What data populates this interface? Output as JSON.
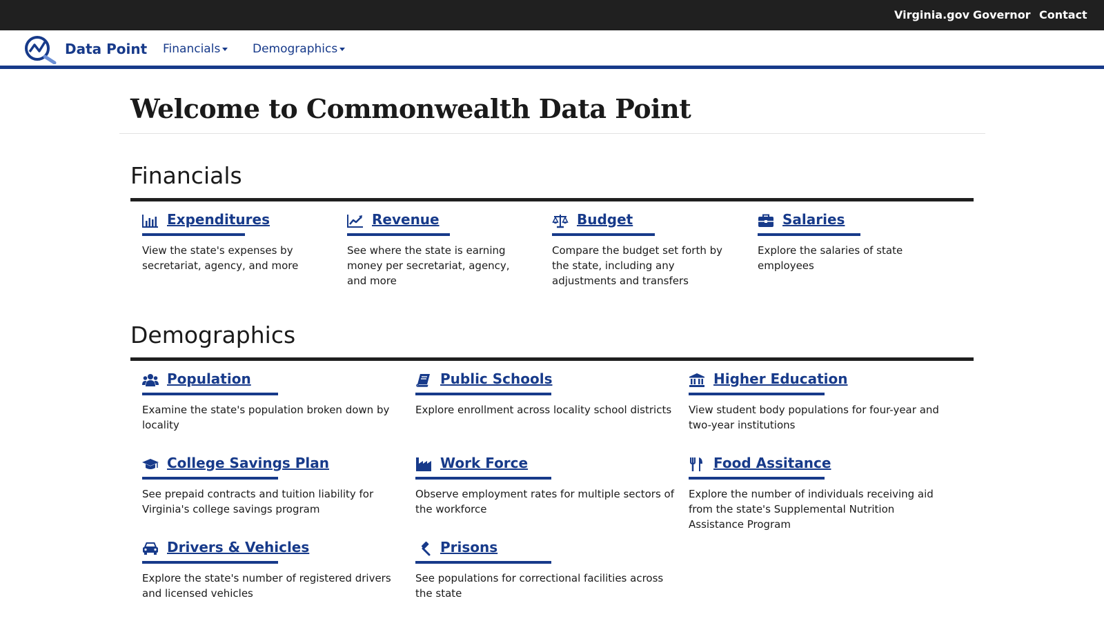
{
  "topbar": {
    "links": [
      "Virginia.gov",
      "Governor",
      "Contact"
    ]
  },
  "navbar": {
    "brand": "Data Point",
    "menus": [
      "Financials",
      "Demographics"
    ]
  },
  "page": {
    "title": "Welcome to Commonwealth Data Point"
  },
  "financials": {
    "heading": "Financials",
    "cards": [
      {
        "title": "Expenditures",
        "icon": "bar-chart-icon",
        "description": "View the state's expenses by secretariat, agency, and more"
      },
      {
        "title": "Revenue",
        "icon": "line-chart-icon",
        "description": "See where the state is earning money per secretariat, agency, and more"
      },
      {
        "title": "Budget",
        "icon": "balance-scale-icon",
        "description": "Compare the budget set forth by the state, including any adjustments and transfers"
      },
      {
        "title": "Salaries",
        "icon": "briefcase-icon",
        "description": "Explore the salaries of state employees"
      }
    ]
  },
  "demographics": {
    "heading": "Demographics",
    "cards": [
      {
        "title": "Population",
        "icon": "users-icon",
        "description": "Examine the state's population broken down by locality"
      },
      {
        "title": "Public Schools",
        "icon": "book-icon",
        "description": "Explore enrollment across locality school districts"
      },
      {
        "title": "Higher Education",
        "icon": "university-icon",
        "description": "View student body populations for four-year and two-year institutions"
      },
      {
        "title": "College Savings Plan",
        "icon": "graduation-cap-icon",
        "description": "See prepaid contracts and tuition liability for Virginia's college savings program"
      },
      {
        "title": "Work Force",
        "icon": "industry-icon",
        "description": "Observe employment rates for multiple sectors of the workforce"
      },
      {
        "title": "Food Assitance",
        "icon": "utensils-icon",
        "description": "Explore the number of individuals receiving aid from the state's Supplemental Nutrition Assistance Program"
      },
      {
        "title": "Drivers & Vehicles",
        "icon": "car-icon",
        "description": "Explore the state's number of registered drivers and licensed vehicles"
      },
      {
        "title": "Prisons",
        "icon": "gavel-icon",
        "description": "See populations for correctional facilities across the state"
      }
    ]
  },
  "colors": {
    "brand_blue": "#173a8a",
    "topbar": "#202020",
    "text": "#1a1a1a"
  }
}
